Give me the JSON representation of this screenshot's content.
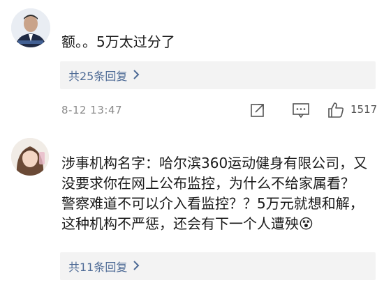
{
  "comments": [
    {
      "text_lines": [
        "额。。5万太过分了"
      ],
      "replies_label": "共25条回复",
      "timestamp": "8-12 13:47",
      "likes": "1517"
    },
    {
      "text_lines": [
        "涉事机构名字：哈尔滨360运动健身有限公司，又",
        "没要求你在网上公布监控，为什么不给家属看？",
        "警察难道不可以介入看监控？？5万元就想和解，",
        "这种机构不严惩，还会有下一个人遭殃😵"
      ],
      "replies_label": "共11条回复"
    }
  ],
  "icons": {
    "share": "share-icon",
    "comment": "comment-icon",
    "like": "like-icon",
    "chevron": "chevron-right-icon"
  },
  "colors": {
    "link": "#4e6b96",
    "muted": "#8a8a8a",
    "reply_bg": "#f3f3f3"
  }
}
